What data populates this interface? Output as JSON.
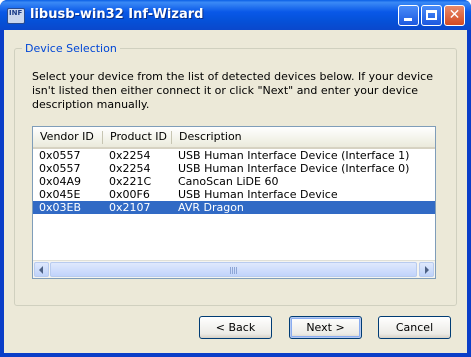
{
  "window": {
    "title": "libusb-win32 Inf-Wizard",
    "icon_label": "INF"
  },
  "group": {
    "label": "Device Selection",
    "instructions": "Select your device from the list of detected devices below. If your device isn't listed then either connect it or click \"Next\" and enter your device description manually."
  },
  "list": {
    "columns": [
      "Vendor ID",
      "Product ID",
      "Description"
    ],
    "rows": [
      {
        "vendor": "0x0557",
        "product": "0x2254",
        "description": "USB Human Interface Device (Interface 1)"
      },
      {
        "vendor": "0x0557",
        "product": "0x2254",
        "description": "USB Human Interface Device (Interface 0)"
      },
      {
        "vendor": "0x04A9",
        "product": "0x221C",
        "description": "CanoScan LiDE 60"
      },
      {
        "vendor": "0x045E",
        "product": "0x00F6",
        "description": "USB Human Interface Device"
      },
      {
        "vendor": "0x03EB",
        "product": "0x2107",
        "description": "AVR Dragon"
      }
    ],
    "selected_index": 4
  },
  "buttons": {
    "back": "< Back",
    "next": "Next >",
    "cancel": "Cancel"
  },
  "colors": {
    "selection": "#316ac5",
    "group_label": "#0046d5",
    "titlebar": "#0958e8"
  }
}
